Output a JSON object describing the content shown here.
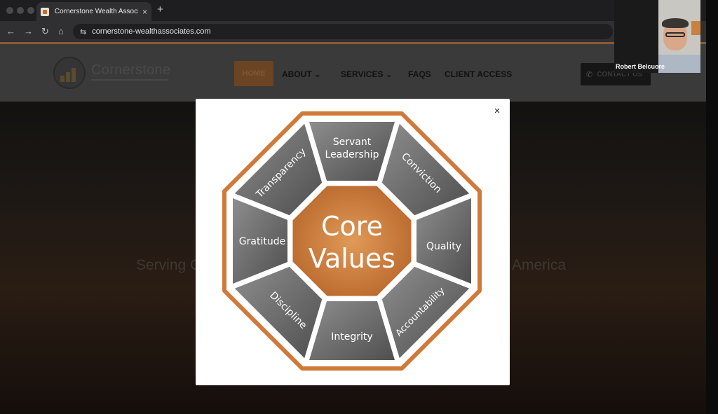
{
  "browser": {
    "tab_title": "Cornerstone Wealth Associat",
    "tab_close": "×",
    "new_tab": "+",
    "url": "cornerstone-wealthassociates.com",
    "nav_back": "←",
    "nav_forward": "→",
    "nav_reload": "↻",
    "nav_home": "⌂",
    "site_settings": "⇆"
  },
  "site": {
    "logo_text": "Cornerstone",
    "nav": {
      "home": "HOME",
      "about": "ABOUT ⌄",
      "services": "SERVICES ⌄",
      "faqs": "FAQS",
      "client_access": "CLIENT ACCESS",
      "contact": "CONTACT US"
    },
    "hero_left": "Serving C",
    "hero_right": "America"
  },
  "video": {
    "participant_name": "Robert Belcuore"
  },
  "modal": {
    "close_label": "×",
    "diagram": {
      "center_line1": "Core",
      "center_line2": "Values",
      "values": {
        "servant_1": "Servant",
        "servant_2": "Leadership",
        "conviction": "Conviction",
        "quality": "Quality",
        "accountability": "Accountability",
        "integrity": "Integrity",
        "discipline": "Discipline",
        "gratitude": "Gratitude",
        "transparency": "Transparency"
      }
    }
  },
  "colors": {
    "accent_orange": "#d07a3a",
    "segment_gray": "#6d6d6d"
  }
}
